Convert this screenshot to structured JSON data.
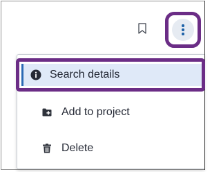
{
  "toolbar": {
    "bookmark_icon": "bookmark-outline-icon",
    "more_icon": "more-vertical-icon"
  },
  "menu": {
    "items": [
      {
        "label": "Search details",
        "icon": "info-circle-icon",
        "highlighted": true
      },
      {
        "label": "Add to project",
        "icon": "folder-plus-icon",
        "highlighted": false
      },
      {
        "label": "Delete",
        "icon": "trash-icon",
        "highlighted": false
      }
    ]
  },
  "colors": {
    "highlight_border": "#6b2d86",
    "selected_bg": "#dfe9f8",
    "selected_accent": "#2a6ab4",
    "icon_dark": "#2e323b",
    "more_button_bg": "#e6ebf2",
    "more_dots": "#1f63a8"
  }
}
